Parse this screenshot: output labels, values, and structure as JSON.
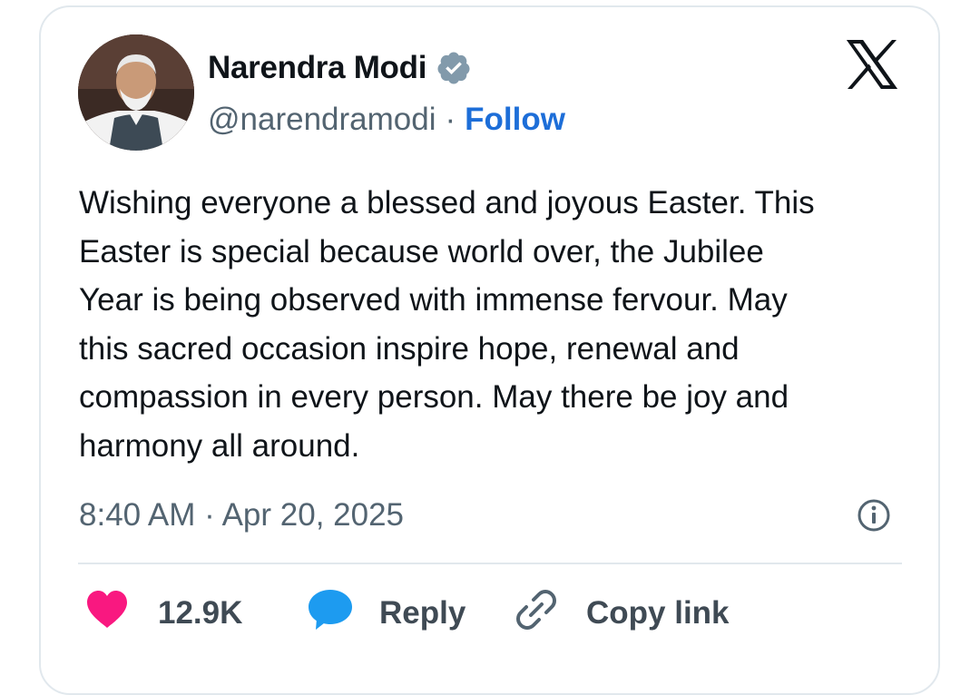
{
  "tweet": {
    "author": {
      "name": "Narendra Modi",
      "handle": "@narendramodi",
      "separator": "·",
      "follow_label": "Follow",
      "verified_icon": "verified-badge-icon",
      "avatar": "avatar-photo"
    },
    "brand_icon": "x-logo-icon",
    "text": "Wishing everyone a blessed and joyous Easter. This\nEaster is special because world over, the Jubilee\nYear is being observed with immense fervour. May\nthis sacred occasion inspire hope, renewal and\ncompassion in every person. May there be joy and\nharmony all around.",
    "timestamp": "8:40 AM · Apr 20, 2025",
    "info_icon": "info-icon",
    "actions": {
      "like_count": "12.9K",
      "like_icon": "heart-icon",
      "reply_label": "Reply",
      "reply_icon": "speech-bubble-icon",
      "copy_label": "Copy link",
      "copy_icon": "link-icon"
    }
  },
  "colors": {
    "text": "#0f1419",
    "secondary": "#536471",
    "follow": "#1d6ed8",
    "heart": "#f91880",
    "reply_bubble": "#1d9bf0",
    "verified": "#829aab",
    "border": "#e1e8ed"
  }
}
